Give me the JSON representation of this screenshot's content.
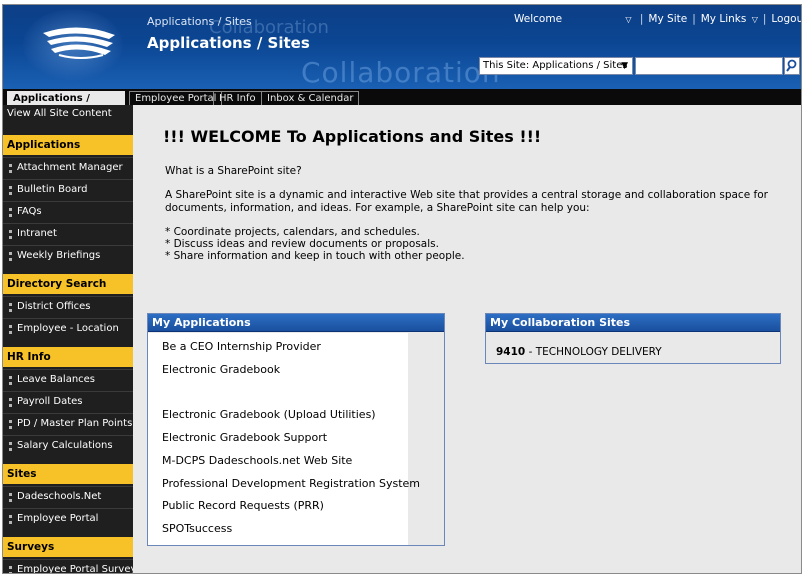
{
  "header": {
    "breadcrumb": "Applications / Sites",
    "title": "Applications / Sites",
    "watermark_top": "Collaboration",
    "watermark_main": "Collaboration",
    "welcome": "Welcome",
    "links": [
      "My Site",
      "My Links",
      "Logout"
    ],
    "search_scope": "This Site: Applications / Sites",
    "search_value": "",
    "help_icon": "help-icon",
    "search_icon": "search-icon"
  },
  "tabs": [
    "Applications / Sites",
    "Employee Portal",
    "HR Info",
    "Inbox & Calendar"
  ],
  "leftnav": {
    "view_all": "View All Site Content",
    "sections": [
      {
        "heading": "Applications",
        "items": [
          "Attachment Manager",
          "Bulletin Board",
          "FAQs",
          "Intranet",
          "Weekly Briefings"
        ]
      },
      {
        "heading": "Directory Search",
        "items": [
          "District Offices",
          "Employee - Location"
        ]
      },
      {
        "heading": "HR Info",
        "items": [
          "Leave Balances",
          "Payroll Dates",
          "PD / Master Plan Points",
          "Salary Calculations"
        ]
      },
      {
        "heading": "Sites",
        "items": [
          "Dadeschools.Net",
          "Employee Portal"
        ]
      },
      {
        "heading": "Surveys",
        "items": [
          "Employee Portal Survey"
        ]
      }
    ]
  },
  "main": {
    "welcome_title": "!!! WELCOME  To Applications and Sites !!!",
    "question": "What is a SharePoint site?",
    "intro_line1": "A SharePoint site is a dynamic and interactive Web site that provides a central storage and collaboration space for",
    "intro_line2": "documents, information, and ideas. For example, a SharePoint site can help you:",
    "bullets": [
      "* Coordinate projects, calendars, and schedules.",
      "* Discuss ideas and review documents or proposals.",
      "* Share information and keep in touch with other people."
    ],
    "my_applications": {
      "title": "My Applications",
      "items": [
        "Be a CEO Internship Provider",
        "Electronic Gradebook",
        "Electronic Gradebook (Upload Utilities)",
        "Electronic Gradebook Support",
        "M-DCPS Dadeschools.net Web Site",
        "Professional Development Registration System",
        "Public Record Requests (PRR)",
        "SPOTsuccess"
      ]
    },
    "my_collab_sites": {
      "title": "My Collaboration Sites",
      "site_code": "9410",
      "site_name": " - TECHNOLOGY DELIVERY"
    }
  },
  "colors": {
    "header_blue": "#0b4693",
    "nav_yellow": "#f7c228",
    "nav_dark": "#1f1f1f",
    "webpart_blue": "#1f5aa8"
  }
}
